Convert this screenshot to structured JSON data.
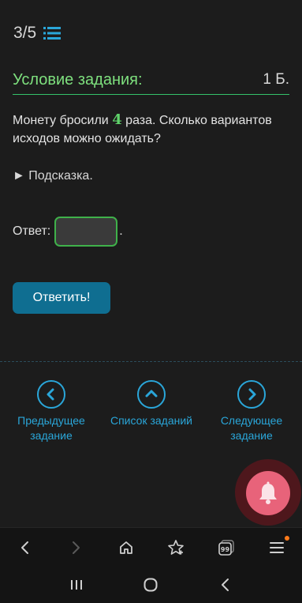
{
  "header": {
    "progress": "3/5",
    "list_icon": "list-icon"
  },
  "condition": {
    "title": "Условие задания:",
    "points": "1 Б."
  },
  "task": {
    "text_before": "Монету бросили ",
    "number": "4",
    "text_after": " раза. Сколько вариантов исходов можно ожидать?"
  },
  "hint": {
    "label": "► Подсказка."
  },
  "answer": {
    "label": "Ответ:",
    "value": "",
    "placeholder": "",
    "suffix": "."
  },
  "submit": {
    "label": "Ответить!"
  },
  "nav": {
    "prev_label": "Предыдущее задание",
    "list_label": "Список заданий",
    "next_label": "Следующее задание"
  },
  "footer": {
    "text": "..."
  },
  "browser_bar": {
    "tabs_count": "99",
    "icons": [
      "back-icon",
      "forward-icon",
      "home-icon",
      "bookmark-star-icon",
      "tabs-icon",
      "menu-icon"
    ]
  },
  "colors": {
    "accent_green": "#7ee07e",
    "accent_blue": "#2aa6d9",
    "button_blue": "#0f6e91",
    "bell_pink": "#e8637a"
  }
}
